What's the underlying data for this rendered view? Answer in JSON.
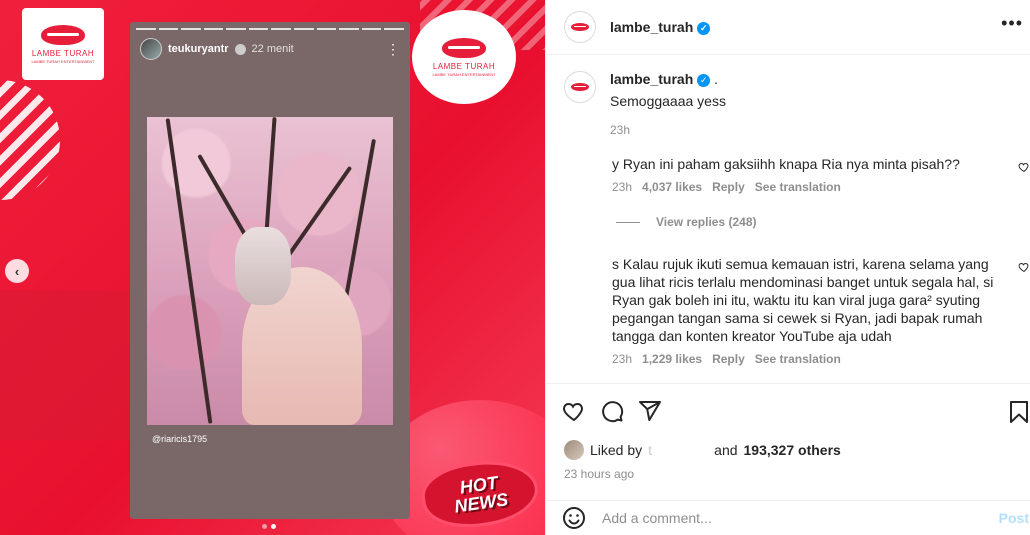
{
  "media": {
    "brand_name": "LAMBE TURAH",
    "brand_tagline": "LAMBE TURAH ENTERTAINMENT",
    "story_user": "teukuryantr",
    "story_time": "22 menit",
    "story_tag": "@riaricis1795",
    "hot_news_line1": "HOT",
    "hot_news_line2": "NEWS",
    "prev_icon": "chevron-left-icon",
    "carousel_count": 2,
    "carousel_active": 2
  },
  "header": {
    "username": "lambe_turah",
    "more_icon": "more-horizontal-icon"
  },
  "caption": {
    "username": "lambe_turah",
    "suffix": ".",
    "text": "Semoggaaaa yess",
    "time": "23h"
  },
  "comments": [
    {
      "user": "",
      "text": "y Ryan ini paham gaksiihh knapa Ria nya minta pisah??",
      "time": "23h",
      "likes": "4,037 likes",
      "reply": "Reply",
      "translate": "See translation"
    },
    {
      "user": "",
      "text": "s Kalau rujuk ikuti semua kemauan istri, karena selama yang gua lihat ricis terlalu mendominasi banget untuk segala hal, si Ryan gak boleh ini itu, waktu itu kan viral juga gara² syuting pegangan tangan sama si cewek si Ryan, jadi bapak rumah tangga dan konten kreator YouTube aja udah",
      "time": "23h",
      "likes": "1,229 likes",
      "reply": "Reply",
      "translate": "See translation"
    }
  ],
  "view_replies": "View replies (248)",
  "likes": {
    "prefix": "Liked by",
    "hidden_user": "t",
    "and": "and",
    "others": "193,327 others"
  },
  "post_time": "23 hours ago",
  "add_comment": {
    "placeholder": "Add a comment...",
    "post_label": "Post"
  },
  "colors": {
    "brand_red": "#e61e3a",
    "verified_blue": "#0095f6",
    "muted_text": "#8e8e8e"
  }
}
